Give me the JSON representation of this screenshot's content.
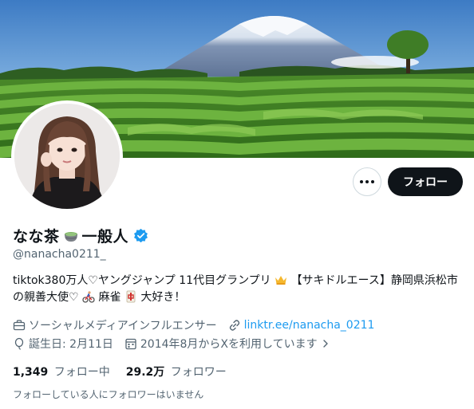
{
  "profile": {
    "display_name": "なな茶",
    "name_suffix": "一般人",
    "handle": "@nanacha0211_",
    "bio_part1": "tiktok380万人♡ヤングジャンプ 11代目グランプリ",
    "bio_part2": " 【サキドルエース】静岡県浜松市の親善大使♡",
    "bio_part3": "麻雀",
    "bio_part4": "大好き！",
    "category": "ソーシャルメディアインフルエンサー",
    "link": "linktr.ee/nanacha_0211",
    "birthday": "誕生日: 2月11日",
    "joined": "2014年8月からXを利用しています"
  },
  "actions": {
    "follow_label": "フォロー"
  },
  "stats": {
    "following_count": "1,349",
    "following_label": "フォロー中",
    "followers_count": "29.2万",
    "followers_label": "フォロワー"
  },
  "note": "フォローしている人にフォロワーはいません",
  "icons": [
    "more-icon",
    "verified-icon",
    "matcha-icon",
    "crown-icon",
    "cyclist-icon",
    "mahjong-tile-icon",
    "briefcase-icon",
    "link-icon",
    "birthday-icon",
    "calendar-icon",
    "chevron-right-icon"
  ],
  "colors": {
    "accent": "#1d9bf0",
    "text": "#0f1419",
    "secondary": "#536471",
    "follow_button": "#0f1419"
  }
}
